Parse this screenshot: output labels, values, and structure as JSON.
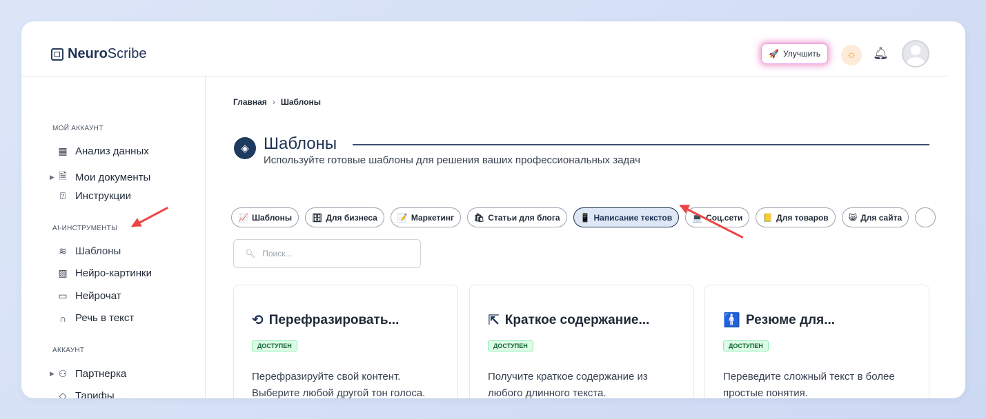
{
  "header": {
    "logo_bold": "Neuro",
    "logo_rest": "Scribe",
    "upgrade_label": "Улучшить"
  },
  "sidebar": {
    "sections": [
      {
        "title": "МОЙ АККАУНТ",
        "items": [
          {
            "label": "Анализ данных",
            "icon": "dashboard-icon"
          },
          {
            "label": "Мои документы",
            "icon": "document-icon",
            "expandable": true
          },
          {
            "label": "Инструкции",
            "icon": "help-icon"
          }
        ]
      },
      {
        "title": "AI-ИНСТРУМЕНТЫ",
        "items": [
          {
            "label": "Шаблоны",
            "icon": "layers-icon",
            "active": true
          },
          {
            "label": "Нейро-картинки",
            "icon": "image-icon"
          },
          {
            "label": "Нейрочат",
            "icon": "chat-icon"
          },
          {
            "label": "Речь в текст",
            "icon": "headphones-icon"
          }
        ]
      },
      {
        "title": "АККАУНТ",
        "items": [
          {
            "label": "Партнерка",
            "icon": "users-icon",
            "expandable": true
          },
          {
            "label": "Тарифы",
            "icon": "tag-icon"
          }
        ]
      }
    ]
  },
  "breadcrumb": [
    "Главная",
    "Шаблоны"
  ],
  "page": {
    "title": "Шаблоны",
    "subtitle": "Используйте готовые шаблоны для решения ваших профессиональных задач"
  },
  "filters": [
    {
      "label": "Шаблоны",
      "icon": "📈"
    },
    {
      "label": "Для бизнеса",
      "icon": "🗄"
    },
    {
      "label": "Маркетинг",
      "icon": "📝"
    },
    {
      "label": "Статьи для блога",
      "icon": "🛍"
    },
    {
      "label": "Написание текстов",
      "icon": "📱",
      "active": true
    },
    {
      "label": "Соц.сети",
      "icon": "💻"
    },
    {
      "label": "Для товаров",
      "icon": "📒"
    },
    {
      "label": "Для сайта",
      "icon": "😸"
    }
  ],
  "search": {
    "placeholder": "Поиск..."
  },
  "cards": [
    {
      "title": "Перефразировать...",
      "icon": "refresh-icon",
      "glyph": "⟲",
      "badge": "ДОСТУПЕН",
      "description": "Перефразируйте свой контент. Выберите любой другой тон голоса."
    },
    {
      "title": "Краткое содержание...",
      "icon": "compress-icon",
      "glyph": "⇱",
      "badge": "ДОСТУПЕН",
      "description": "Получите краткое содержание из любого длинного текста."
    },
    {
      "title": "Резюме для...",
      "icon": "person-icon",
      "glyph": "🚹",
      "badge": "ДОСТУПЕН",
      "description": "Переведите сложный текст в более простые понятия."
    }
  ],
  "colors": {
    "accent": "#1f3354",
    "badge_bg": "#dcfce7",
    "arrow": "#ef4444",
    "upgrade_glow": "#e878e6"
  }
}
